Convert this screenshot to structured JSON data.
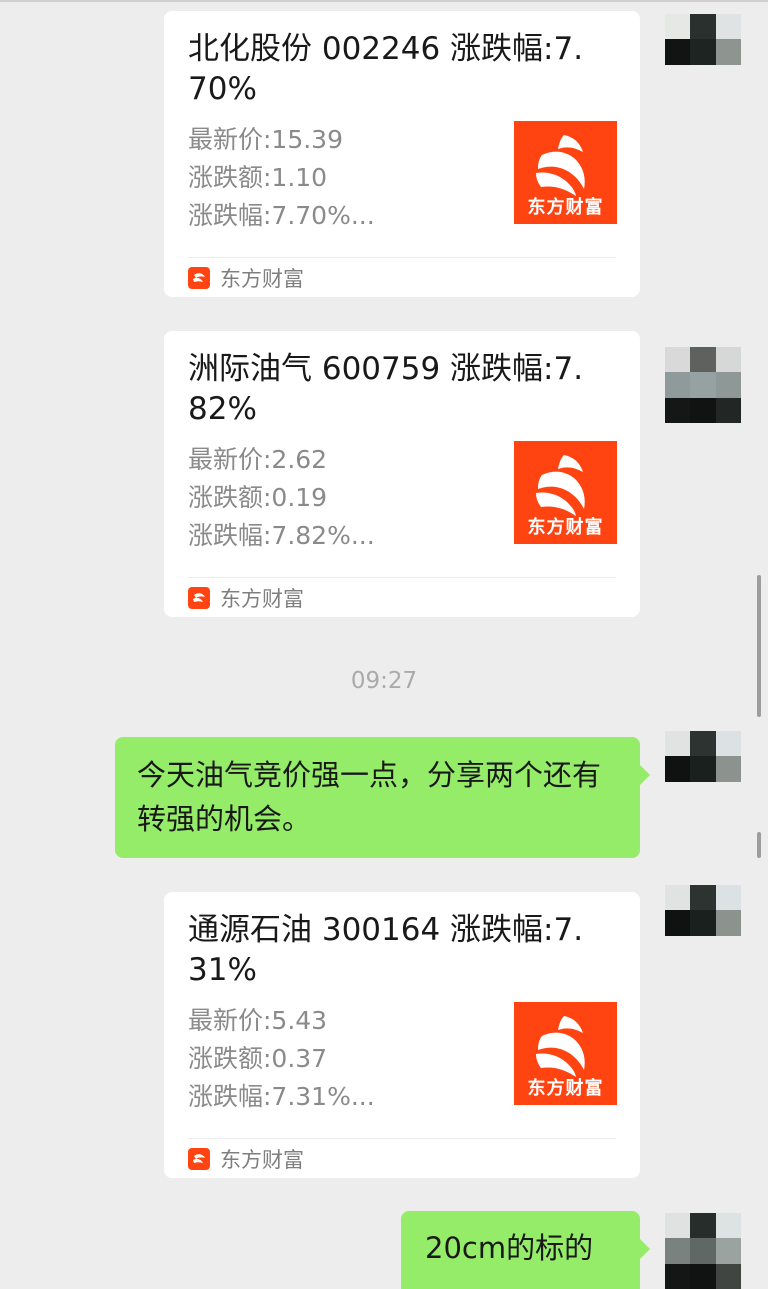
{
  "cards": [
    {
      "title": "北化股份 002246 涨跌幅:7.70%",
      "lines": [
        "最新价:15.39",
        "涨跌额:1.10",
        "涨跌幅:7.70%..."
      ],
      "thumb_text": "东方财富",
      "source": "东方财富"
    },
    {
      "title": "洲际油气 600759 涨跌幅:7.82%",
      "lines": [
        "最新价:2.62",
        "涨跌额:0.19",
        "涨跌幅:7.82%..."
      ],
      "thumb_text": "东方财富",
      "source": "东方财富"
    },
    {
      "title": "通源石油 300164 涨跌幅:7.31%",
      "lines": [
        "最新价:5.43",
        "涨跌额:0.37",
        "涨跌幅:7.31%..."
      ],
      "thumb_text": "东方财富",
      "source": "东方财富"
    }
  ],
  "timestamp": "09:27",
  "messages": {
    "m1": "今天油气竞价强一点，分享两个还有转强的机会。",
    "m2": "20cm的标的"
  },
  "colors": {
    "background": "#ededed",
    "bubble": "#95ec69",
    "brand": "#ff4411"
  }
}
